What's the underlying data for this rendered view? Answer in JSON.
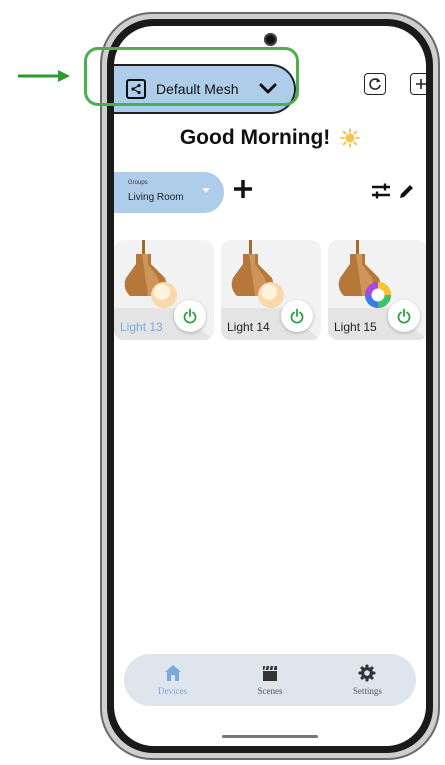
{
  "top_bar": {
    "mesh_name": "Default Mesh",
    "refresh_icon": "refresh-icon",
    "add_icon": "plus-icon"
  },
  "greeting": "Good Morning!",
  "groups": {
    "small_label": "Groups",
    "selected": "Living Room"
  },
  "devices": [
    {
      "label": "Light 13",
      "active": true,
      "bulb": "warm"
    },
    {
      "label": "Light 14",
      "active": false,
      "bulb": "warm"
    },
    {
      "label": "Light 15",
      "active": false,
      "bulb": "rgb"
    }
  ],
  "nav": {
    "devices": "Devices",
    "scenes": "Scenes",
    "settings": "Settings"
  },
  "colors": {
    "accent": "#aecdea",
    "active_text": "#7aa8df",
    "power_green": "#2ea043",
    "annotation": "#2e9a2e"
  }
}
